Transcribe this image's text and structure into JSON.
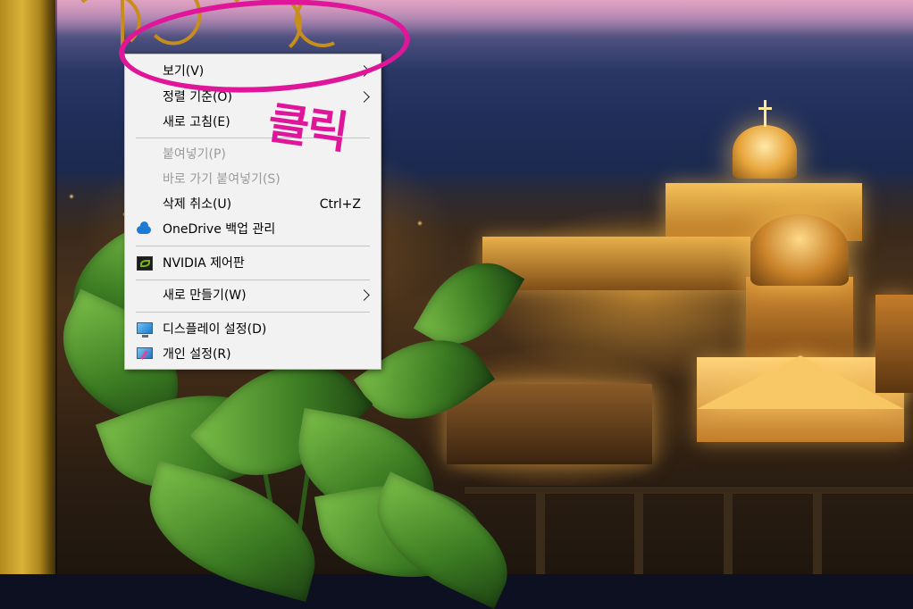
{
  "context_menu": {
    "items": [
      {
        "label": "보기(V)",
        "submenu": true,
        "disabled": false
      },
      {
        "label": "정렬 기준(O)",
        "submenu": true,
        "disabled": false
      },
      {
        "label": "새로 고침(E)",
        "submenu": false,
        "disabled": false
      },
      {
        "label": "붙여넣기(P)",
        "submenu": false,
        "disabled": true
      },
      {
        "label": "바로 가기 붙여넣기(S)",
        "submenu": false,
        "disabled": true
      },
      {
        "label": "삭제 취소(U)",
        "shortcut": "Ctrl+Z",
        "submenu": false,
        "disabled": false
      },
      {
        "label": "OneDrive 백업 관리",
        "icon": "onedrive-cloud-icon",
        "submenu": false,
        "disabled": false
      },
      {
        "label": "NVIDIA 제어판",
        "icon": "nvidia-icon",
        "submenu": false,
        "disabled": false
      },
      {
        "label": "새로 만들기(W)",
        "submenu": true,
        "disabled": false
      },
      {
        "label": "디스플레이 설정(D)",
        "icon": "display-settings-icon",
        "submenu": false,
        "disabled": false
      },
      {
        "label": "개인 설정(R)",
        "icon": "personalize-icon",
        "submenu": false,
        "disabled": false
      }
    ]
  },
  "annotation": {
    "text": "클릭",
    "color": "#e0169a"
  },
  "colors": {
    "menu_background": "#f2f2f2",
    "disabled_text": "#9a9a9a",
    "annotation": "#e0169a"
  }
}
